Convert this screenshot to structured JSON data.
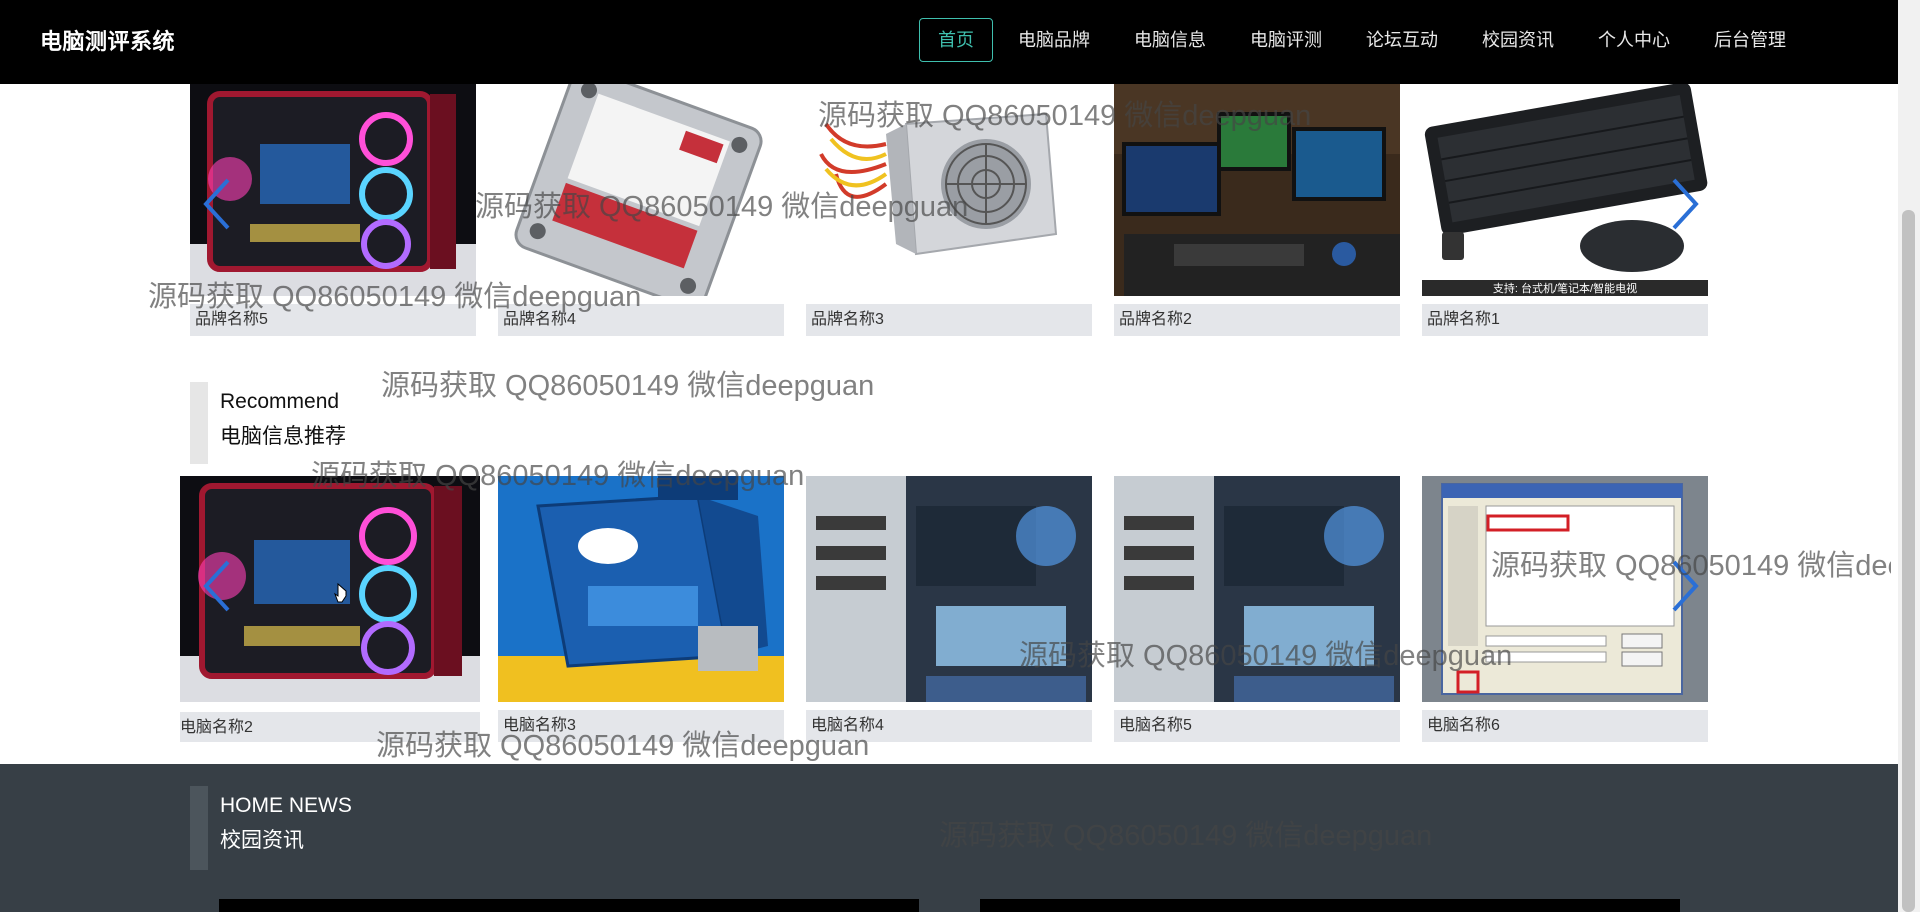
{
  "navbar": {
    "brand": "电脑测评系统",
    "items": [
      "首页",
      "电脑品牌",
      "电脑信息",
      "电脑评测",
      "论坛互动",
      "校园资讯",
      "个人中心",
      "后台管理"
    ]
  },
  "brands": {
    "cards": [
      {
        "name": "品牌名称5",
        "image": "gaming-pc-case"
      },
      {
        "name": "品牌名称4",
        "image": "hard-drive"
      },
      {
        "name": "品牌名称3",
        "image": "power-supply"
      },
      {
        "name": "品牌名称2",
        "image": "gaming-setup"
      },
      {
        "name": "品牌名称1",
        "image": "keyboard-mouse"
      }
    ],
    "keyboard_caption": "支持: 台式机/笔记本/智能电视"
  },
  "recommend": {
    "title_en": "Recommend",
    "title_cn": "电脑信息推荐",
    "cards": [
      {
        "name": "电脑名称2",
        "image": "gaming-pc-case"
      },
      {
        "name": "电脑名称3",
        "image": "intel-box"
      },
      {
        "name": "电脑名称4",
        "image": "pc-internals"
      },
      {
        "name": "电脑名称5",
        "image": "pc-internals"
      },
      {
        "name": "电脑名称6",
        "image": "dialog-screenshot"
      }
    ]
  },
  "news": {
    "title_en": "HOME NEWS",
    "title_cn": "校园资讯"
  },
  "watermark": "源码获取 QQ86050149 微信deepguan",
  "colors": {
    "navbar_bg": "#000000",
    "active_accent": "#3fbfae",
    "arrow": "#2a6fd6",
    "caption_bg": "#e4e6ea",
    "footer_bg": "#373f46"
  }
}
